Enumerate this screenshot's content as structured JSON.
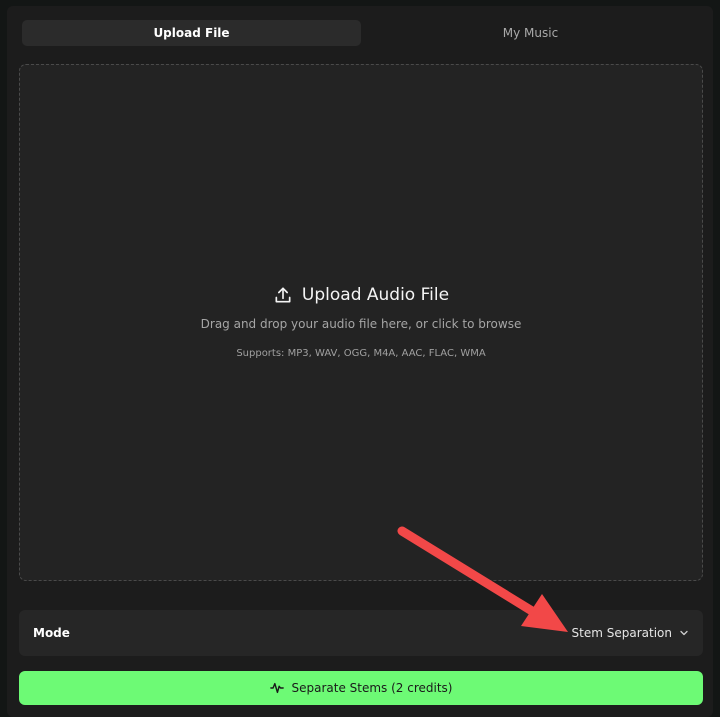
{
  "tabs": [
    {
      "label": "Upload File",
      "active": true
    },
    {
      "label": "My Music",
      "active": false
    }
  ],
  "dropzone": {
    "title": "Upload Audio File",
    "subtitle": "Drag and drop your audio file here, or click to browse",
    "supports": "Supports: MP3, WAV, OGG, M4A, AAC, FLAC, WMA",
    "icon": "upload-icon"
  },
  "mode": {
    "label": "Mode",
    "selected": "Stem Separation",
    "icon": "chevron-down-icon"
  },
  "action": {
    "label": "Separate Stems (2 credits)",
    "icon": "waveform-icon"
  },
  "annotation": {
    "type": "arrow",
    "color": "#f24848",
    "points_to": "mode-select"
  },
  "colors": {
    "accent": "#6dfa75",
    "background": "#1c1c1c",
    "arrow": "#f24848"
  }
}
